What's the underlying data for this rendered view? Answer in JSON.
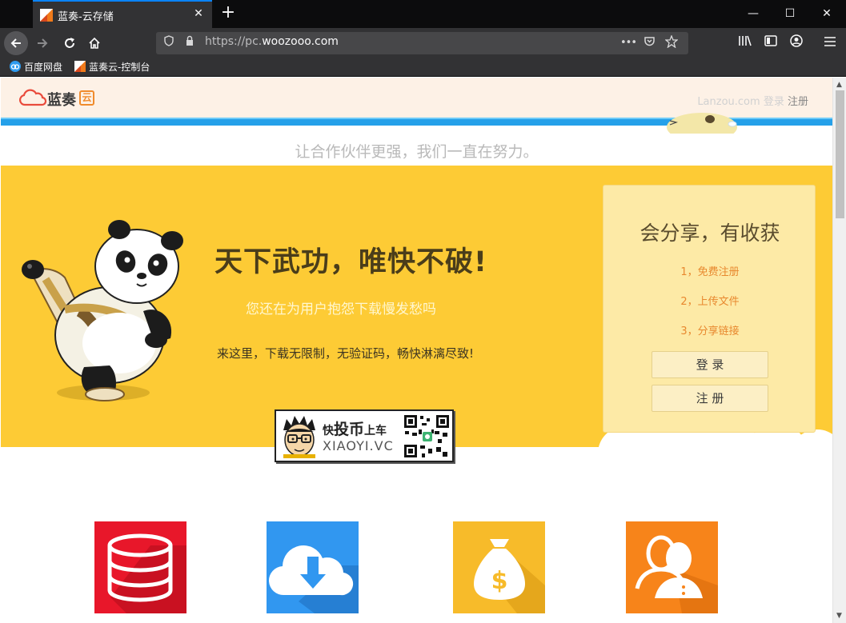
{
  "browser": {
    "tab_title": "蓝奏-云存储",
    "tab_close": "✕",
    "new_tab": "+",
    "url_prefix": "https://pc.",
    "url_domain": "woozooo.com",
    "url_more": "•••",
    "window_minimize": "—",
    "window_maximize": "☐",
    "window_close": "✕",
    "bookmarks": [
      {
        "label": "百度网盘"
      },
      {
        "label": "蓝奏云-控制台"
      }
    ]
  },
  "site": {
    "logo_text": "蓝奏",
    "logo_badge": "云",
    "header_prefix": "Lanzou.com",
    "login_link": "登录",
    "register_link": "注册",
    "slogan": "让合作伙伴更强，我们一直在努力。",
    "hero_title": "天下武功，唯快不破!",
    "hero_sub": "您还在为用户抱怨下载慢发愁吗",
    "hero_desc": "来这里，下载无限制，无验证码，畅快淋漓尽致!",
    "card": {
      "title": "会分享，有收获",
      "steps": [
        "1，免费注册",
        "2，上传文件",
        "3，分享链接"
      ],
      "login_button": "登 录",
      "register_button": "注 册"
    },
    "promo": {
      "line1_a": "快",
      "line1_b": "投币",
      "line1_c": "上车",
      "line2": "XIAOYI.VC"
    },
    "features": [
      {
        "icon": "database-icon",
        "color": "#e8172a"
      },
      {
        "icon": "cloud-download-icon",
        "color": "#3197f0"
      },
      {
        "icon": "money-bag-icon",
        "color": "#f7bb2a"
      },
      {
        "icon": "users-icon",
        "color": "#f7841a"
      }
    ]
  }
}
